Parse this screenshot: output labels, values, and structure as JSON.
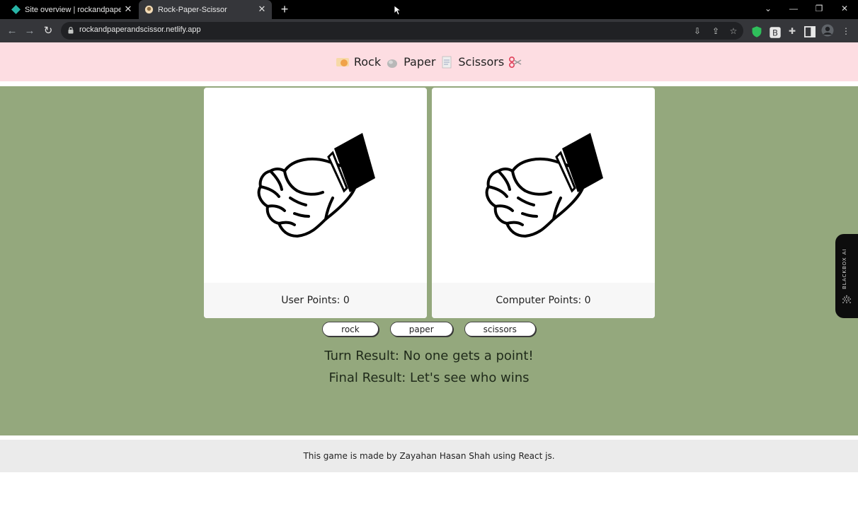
{
  "browser": {
    "tabs": [
      {
        "title": "Site overview | rockandpaperandscissor",
        "active": false,
        "icon": "netlify-icon"
      },
      {
        "title": "Rock-Paper-Scissor",
        "active": true,
        "icon": "react-icon"
      }
    ],
    "url": "rockandpaperandscissor.netlify.app",
    "window_controls": {
      "list": "⌄",
      "minimize": "—",
      "restore": "❐",
      "close": "✕"
    }
  },
  "header": {
    "items": [
      "Rock",
      "Paper",
      "Scissors"
    ],
    "icons": [
      "rock-emoji-icon",
      "paper-emoji-icon",
      "scissors-emoji-icon"
    ]
  },
  "cards": {
    "user": {
      "label": "User Points: 0",
      "hand": "rock",
      "icon": "fist-icon"
    },
    "computer": {
      "label": "Computer Points: 0",
      "hand": "rock",
      "icon": "fist-icon"
    }
  },
  "choices": [
    "rock",
    "paper",
    "scissors"
  ],
  "results": {
    "turn": "Turn Result: No one gets a point!",
    "final": "Final Result: Let's see who wins"
  },
  "blackbox": {
    "label": "BLACKBOX AI"
  },
  "footer": {
    "text": "This game is made by Zayahan Hasan Shah using React js."
  },
  "colors": {
    "header_bg": "#fddde2",
    "main_bg": "#94a87d",
    "footer_bg": "#ebebeb",
    "card_footer_bg": "#f7f7f7"
  }
}
